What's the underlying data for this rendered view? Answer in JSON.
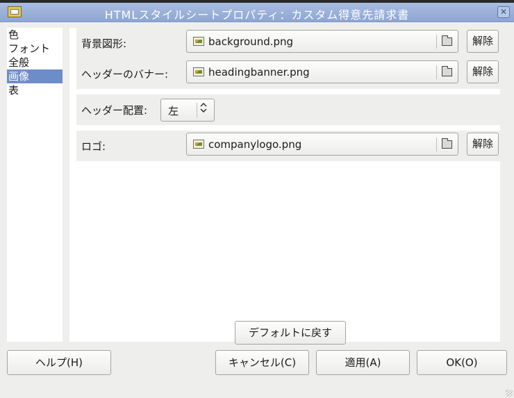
{
  "window": {
    "title": "HTMLスタイルシートプロパティ：カスタム得意先請求書",
    "close_glyph": "✕"
  },
  "sidebar": {
    "items": [
      {
        "label": "色"
      },
      {
        "label": "フォント"
      },
      {
        "label": "全般"
      },
      {
        "label": "画像",
        "selected": true
      },
      {
        "label": "表"
      }
    ]
  },
  "form": {
    "background": {
      "label": "背景図形:",
      "file": "background.png",
      "clear_label": "解除"
    },
    "banner": {
      "label": "ヘッダーのバナー:",
      "file": "headingbanner.png",
      "clear_label": "解除"
    },
    "alignment": {
      "label": "ヘッダー配置:",
      "value": "左",
      "arrow": "⌃⌄"
    },
    "logo": {
      "label": "ロゴ:",
      "file": "companylogo.png",
      "clear_label": "解除"
    }
  },
  "defaults_button": "デフォルトに戻す",
  "buttons": {
    "help": "ヘルプ(H)",
    "cancel": "キャンセル(C)",
    "apply": "適用(A)",
    "ok": "OK(O)"
  },
  "colors": {
    "titlebar": "#9db2da",
    "selection": "#6d8dc9",
    "dialog_bg": "#eeeeec"
  }
}
